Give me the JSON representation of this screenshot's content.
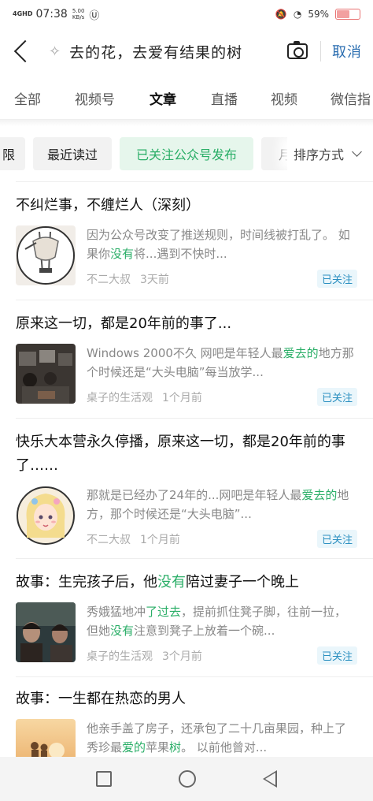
{
  "status_bar": {
    "network": "4GHD",
    "time": "07:38",
    "speed_value": "5.00",
    "speed_unit": "KB/s",
    "battery_percent": "59%",
    "battery_level": 0.59
  },
  "search": {
    "query": "去的花，去爱有结果的树",
    "cancel_label": "取消"
  },
  "tabs": [
    {
      "label": "全部"
    },
    {
      "label": "视频号"
    },
    {
      "label": "文章",
      "active": true
    },
    {
      "label": "直播"
    },
    {
      "label": "视频"
    },
    {
      "label": "微信指"
    }
  ],
  "filters": {
    "chips": [
      "限",
      "最近读过",
      "已关注公众号发布",
      "月"
    ],
    "active_chip": "已关注公众号发布",
    "sort_label": "排序方式"
  },
  "articles": [
    {
      "title": "不纠烂事，不缠烂人（深刻）",
      "snippet_parts": [
        {
          "text": "因为公众号改变了推送规则，时间线被打乱了。 如果你",
          "hl": false
        },
        {
          "text": "没有",
          "hl": true
        },
        {
          "text": "将...遇到不快时...",
          "hl": false
        }
      ],
      "author": "不二大叔",
      "time": "3天前",
      "badge": "已关注",
      "thumb_icon": "sketch-figure-thumbnail"
    },
    {
      "title": "原来这一切，都是20年前的事了...",
      "snippet_parts": [
        {
          "text": "Windows 2000不久 网吧是年轻人最",
          "hl": false
        },
        {
          "text": "爱去的",
          "hl": true
        },
        {
          "text": "地方那个时候还是“大头电脑”每当放学...",
          "hl": false
        }
      ],
      "author": "桌子的生活观",
      "time": "1个月前",
      "badge": "已关注",
      "thumb_icon": "internet-cafe-photo-thumbnail"
    },
    {
      "title": "快乐大本营永久停播，原来这一切，都是20年前的事了……",
      "snippet_parts": [
        {
          "text": "那就是已经办了24年的...网吧是年轻人最",
          "hl": false
        },
        {
          "text": "爱去的",
          "hl": true
        },
        {
          "text": "地方，那个时候还是“大头电脑”...",
          "hl": false
        }
      ],
      "author": "不二大叔",
      "time": "1个月前",
      "badge": "已关注",
      "thumb_icon": "cartoon-girl-avatar-thumbnail"
    },
    {
      "title_parts": [
        {
          "text": "故事：生完孩子后，他",
          "hl": false
        },
        {
          "text": "没有",
          "hl": true
        },
        {
          "text": "陪过妻子一个晚上",
          "hl": false
        }
      ],
      "snippet_parts": [
        {
          "text": "秀娥猛地冲",
          "hl": false
        },
        {
          "text": "了过去",
          "hl": true
        },
        {
          "text": "，提前抓住凳子脚，往前一拉，但她",
          "hl": false
        },
        {
          "text": "没有",
          "hl": true
        },
        {
          "text": "注意到凳子上放着一个碗...",
          "hl": false
        }
      ],
      "author": "桌子的生活观",
      "time": "3个月前",
      "badge": "已关注",
      "thumb_icon": "movie-still-thumbnail"
    },
    {
      "title": "故事：一生都在热恋的男人",
      "snippet_parts": [
        {
          "text": "他亲手盖了房子，还承包了二十几亩果园，种上了秀珍最",
          "hl": false
        },
        {
          "text": "爱的",
          "hl": true
        },
        {
          "text": "苹果",
          "hl": false
        },
        {
          "text": "树",
          "hl": true
        },
        {
          "text": "。 以前他曾对...",
          "hl": false
        }
      ],
      "thumb_icon": "sunset-couple-thumbnail"
    }
  ]
}
